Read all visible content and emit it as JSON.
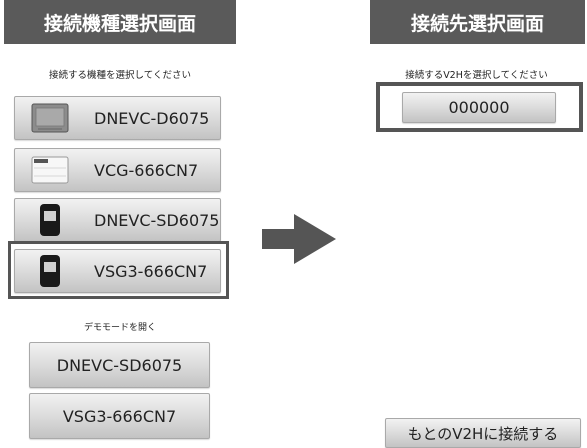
{
  "left_screen": {
    "title": "接続機種選択画面",
    "instruction": "接続する機種を選択してください",
    "models": [
      {
        "label": "DNEVC-D6075",
        "icon": "gray-charger-unit-icon"
      },
      {
        "label": "VCG-666CN7",
        "icon": "white-charger-unit-icon"
      },
      {
        "label": "DNEVC-SD6075",
        "icon": "black-wallbox-icon"
      },
      {
        "label": "VSG3-666CN7",
        "icon": "black-wallbox-icon",
        "selected": true
      }
    ],
    "demo_caption": "デモモードを開く",
    "demo_buttons": [
      "DNEVC-SD6075",
      "VSG3-666CN7"
    ]
  },
  "right_screen": {
    "title": "接続先選択画面",
    "instruction": "接続するV2Hを選択してください",
    "v2h_item": "000000",
    "reconnect_button": "もとのV2Hに接続する"
  },
  "transition_arrow": "right-arrow-icon",
  "colors": {
    "title_bar": "#5a5a5a",
    "highlight_frame": "#555555"
  }
}
